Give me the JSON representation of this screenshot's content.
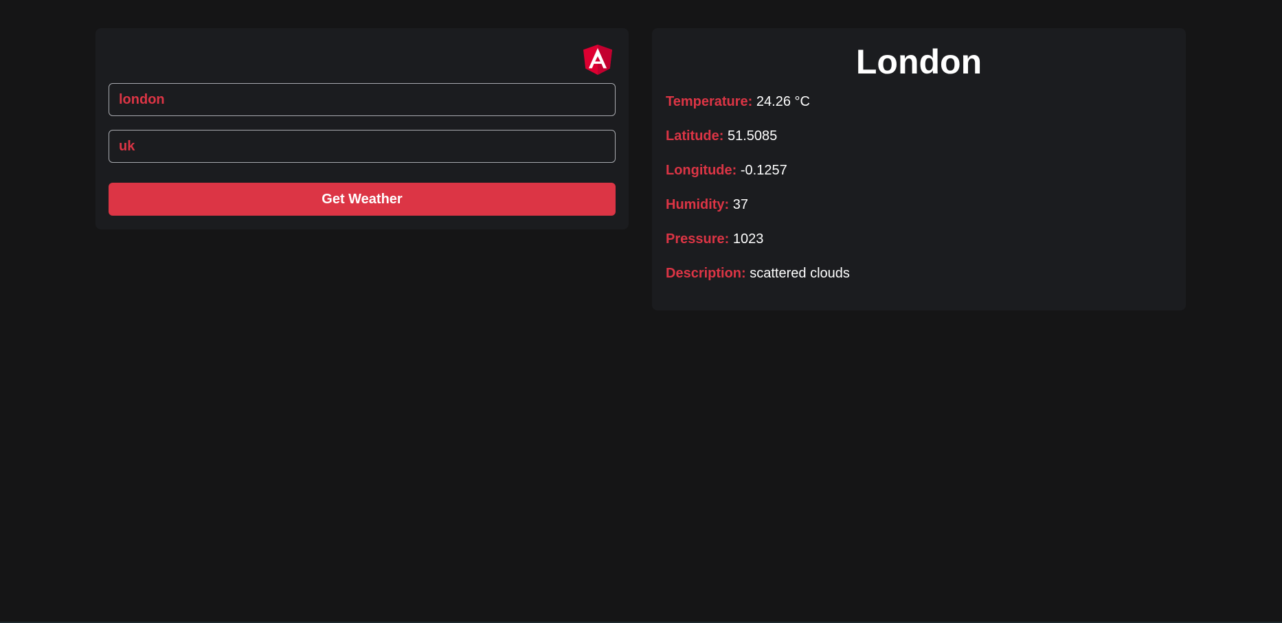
{
  "form": {
    "logo_icon": "angular-logo-icon",
    "city_value": "london",
    "country_value": "uk",
    "submit_label": "Get Weather"
  },
  "weather": {
    "city": "London",
    "fields": [
      {
        "label": "Temperature:",
        "value": "24.26 °C"
      },
      {
        "label": "Latitude:",
        "value": "51.5085"
      },
      {
        "label": "Longitude:",
        "value": "-0.1257"
      },
      {
        "label": "Humidity:",
        "value": "37"
      },
      {
        "label": "Pressure:",
        "value": "1023"
      },
      {
        "label": "Description:",
        "value": "scattered clouds"
      }
    ]
  },
  "colors": {
    "background": "#151516",
    "card": "#1b1c1f",
    "accent": "#dc3545",
    "text": "#ffffff"
  }
}
